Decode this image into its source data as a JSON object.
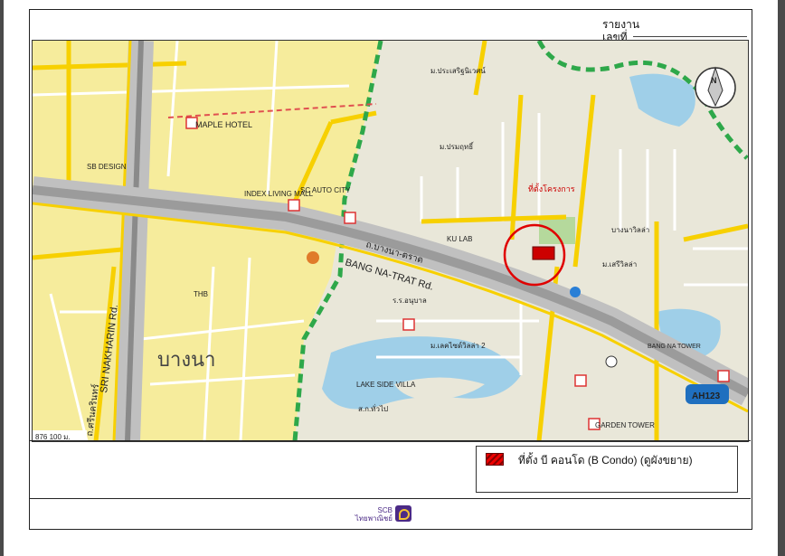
{
  "header": {
    "report_label": "รายงาน",
    "report_sub": "เลขที่"
  },
  "map": {
    "north_label": "N",
    "roads": {
      "bangna_trat_en": "BANG NA-TRAT Rd.",
      "bangna_trat_th": "ถ.บางนา-ตราด",
      "sri_nakharin_en": "SRI NAKHARIN Rd.",
      "sri_nakharin_th": "ถ.ศรีนครินทร์",
      "ah123": "AH123"
    },
    "district_label": "บางนา",
    "labels": {
      "maple_hotel": "MAPLE HOTEL",
      "index_living_mall": "INDEX LIVING MALL",
      "sc_auto_city": "SC AUTO CITY",
      "ku_lab": "KU LAB",
      "lake_side_villa": "LAKE SIDE VILLA",
      "garden_tower": "GARDEN TOWER",
      "sb_design": "SB DESIGN",
      "thb": "THB",
      "bangna_tower": "BANG NA TOWER",
      "project_site": "ที่ตั้งโครงการ",
      "baan_seri": "ม.เสรีวิลล่า",
      "lake_side_villa_2": "ม.เลคไซด์วิลล่า 2",
      "ror_ror_bangna": "ร.ร.อนุบาล",
      "baan_bangna": "บางนาวิลล่า",
      "pracha_uthit": "ม.ปรมฤทธิ์",
      "paradise": "ม.ประเสริฐนิเวศน์",
      "sor_kor": "ส.ก.ทั่วไป"
    },
    "scale_text": "876  100 ม."
  },
  "legend": {
    "label": "ที่ตั้ง บี คอนโด (B Condo) (ดูผังขยาย)",
    "swatch_color": "#cc0000"
  },
  "footer": {
    "logo_line1": "SCB",
    "logo_line2": "ไทยพาณิชย์"
  }
}
